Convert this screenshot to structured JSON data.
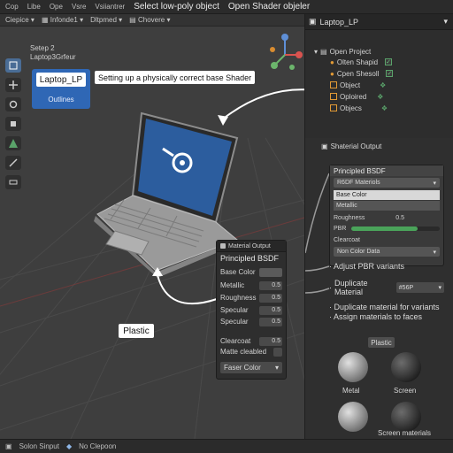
{
  "topbar": {
    "menus": [
      "Cop",
      "Libe",
      "Ope",
      "Vsre",
      "Vsiiantrer"
    ],
    "title": "Select low-poly object",
    "title2": "Open Shader objeler",
    "chip1": "Ciepice",
    "chip2": "Infonde1",
    "chip3": "Dltpmed",
    "chip4": "Chovere"
  },
  "viewport": {
    "scene_line1": "Setep 2",
    "scene_line2": "Laptop3Grfeur",
    "object_name": "Laptop_LP",
    "outlines_label": "Outlines",
    "tooltip": "Setting up a physically correct base Shader",
    "plastic_label": "Plastic"
  },
  "material_popup": {
    "header": "Material Output",
    "subtitle": "Principled BSDF",
    "rows": [
      {
        "label": "Base Color",
        "value": ""
      },
      {
        "label": "Metallic",
        "value": "0.5"
      },
      {
        "label": "Roughness",
        "value": "0.5"
      },
      {
        "label": "Specular",
        "value": "0.5"
      },
      {
        "label": "Specular",
        "value": "0.5"
      },
      {
        "label": "Clearcoat",
        "value": "0.5"
      },
      {
        "label": "Matte cleabled",
        "value": ""
      }
    ],
    "faser": "Faser Color"
  },
  "statusbar": {
    "item1": "Solon Sinput",
    "item2": "No Clepoon"
  },
  "outliner": {
    "title": "Laptop_LP",
    "rows": [
      {
        "label": "Open Project",
        "icon": "collection"
      },
      {
        "label": "Olten Shapid",
        "icon": "tick"
      },
      {
        "label": "Cpen Shesoll",
        "icon": "tick"
      },
      {
        "label": "Object",
        "icon": "mesh"
      },
      {
        "label": "Oploired",
        "icon": "mesh"
      },
      {
        "label": "Objecs",
        "icon": "mesh"
      }
    ]
  },
  "shader": {
    "header": "Shaterial Output",
    "node_title": "Principled BSDF",
    "select_label": "R6DF Materiols",
    "base_color": "Base Color",
    "metallic": "Metallic",
    "roughness_label": "Roughness",
    "roughness_value": "0.5",
    "pbr_label": "PBR",
    "pbr_fill": 0.75,
    "clearcoat": "Clearcoat",
    "non_color": "Non Color Data",
    "adjust": "Adjust PBR variants",
    "duplicate": "Duplicate Material",
    "duplicate_dd": "#56P",
    "dup_variants": "Duplicate material for variants",
    "assign": "Assign materials to faces",
    "plastic_tag": "Plastic",
    "sphere_labels": [
      "Metal",
      "Screen",
      "Screen materials"
    ]
  },
  "colors": {
    "accent_blue": "#2f67b5",
    "green_check": "#5aa36a",
    "orange_mesh": "#e29a35"
  }
}
